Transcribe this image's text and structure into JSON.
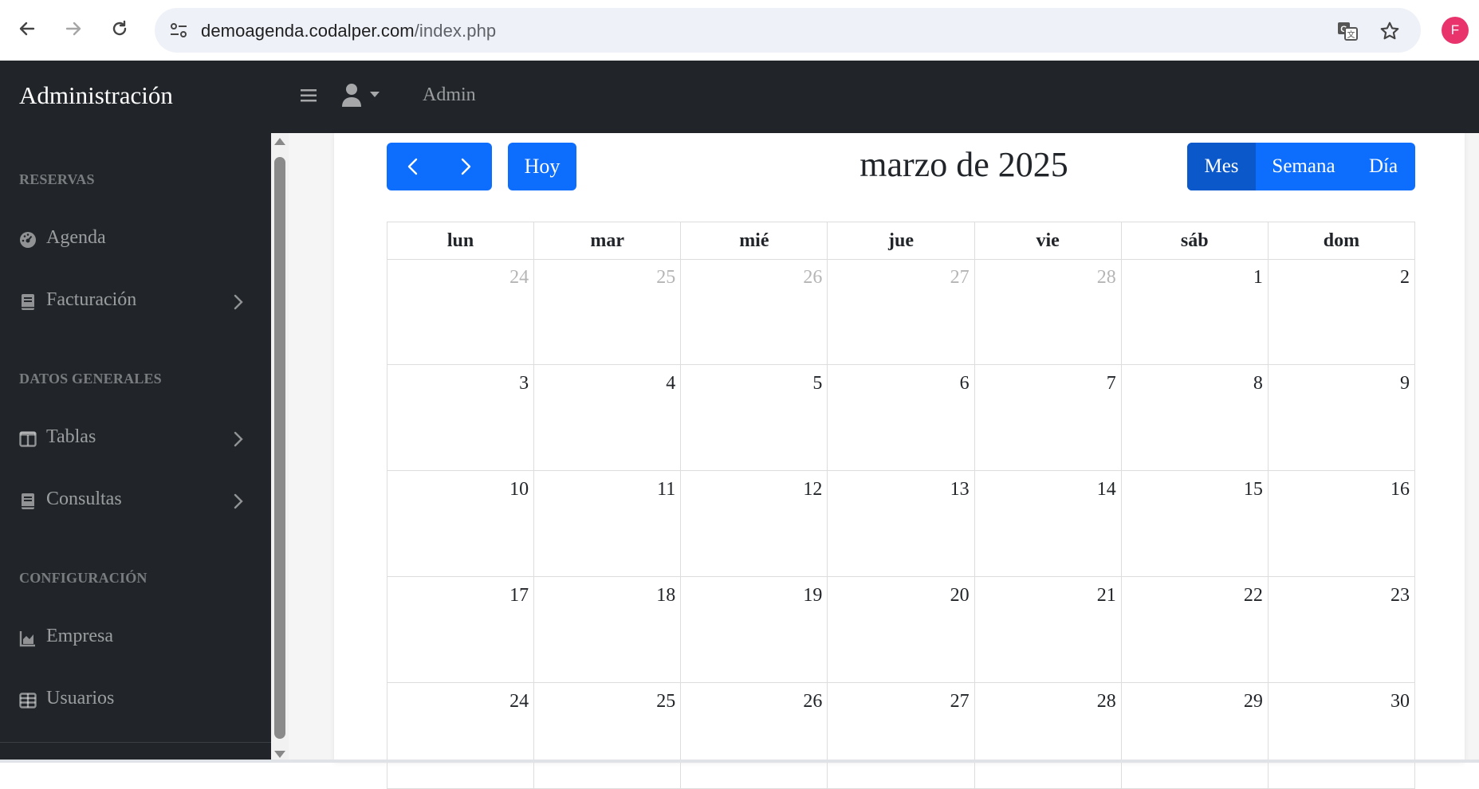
{
  "browser": {
    "url_host": "demoagenda.codalper.com",
    "url_path": "/index.php",
    "profile_initial": "F"
  },
  "app": {
    "brand": "Administración",
    "user_menu_label": "Admin"
  },
  "sidebar": {
    "sections": [
      {
        "heading": "RESERVAS",
        "items": [
          {
            "label": "Agenda",
            "icon": "dashboard-gauge-icon",
            "has_submenu": false
          },
          {
            "label": "Facturación",
            "icon": "book-icon",
            "has_submenu": true
          }
        ]
      },
      {
        "heading": "DATOS GENERALES",
        "items": [
          {
            "label": "Tablas",
            "icon": "columns-icon",
            "has_submenu": true
          },
          {
            "label": "Consultas",
            "icon": "book-icon",
            "has_submenu": true
          }
        ]
      },
      {
        "heading": "CONFIGURACIÓN",
        "items": [
          {
            "label": "Empresa",
            "icon": "chart-area-icon",
            "has_submenu": false
          },
          {
            "label": "Usuarios",
            "icon": "table-icon",
            "has_submenu": false
          }
        ]
      }
    ]
  },
  "calendar": {
    "today_label": "Hoy",
    "title": "marzo de 2025",
    "views": [
      {
        "label": "Mes",
        "active": true
      },
      {
        "label": "Semana",
        "active": false
      },
      {
        "label": "Día",
        "active": false
      }
    ],
    "weekdays": [
      "lun",
      "mar",
      "mié",
      "jue",
      "vie",
      "sáb",
      "dom"
    ],
    "weeks": [
      [
        {
          "d": "24",
          "o": true
        },
        {
          "d": "25",
          "o": true
        },
        {
          "d": "26",
          "o": true
        },
        {
          "d": "27",
          "o": true
        },
        {
          "d": "28",
          "o": true
        },
        {
          "d": "1",
          "o": false
        },
        {
          "d": "2",
          "o": false
        }
      ],
      [
        {
          "d": "3",
          "o": false
        },
        {
          "d": "4",
          "o": false
        },
        {
          "d": "5",
          "o": false
        },
        {
          "d": "6",
          "o": false
        },
        {
          "d": "7",
          "o": false
        },
        {
          "d": "8",
          "o": false
        },
        {
          "d": "9",
          "o": false
        }
      ],
      [
        {
          "d": "10",
          "o": false
        },
        {
          "d": "11",
          "o": false
        },
        {
          "d": "12",
          "o": false
        },
        {
          "d": "13",
          "o": false
        },
        {
          "d": "14",
          "o": false
        },
        {
          "d": "15",
          "o": false
        },
        {
          "d": "16",
          "o": false
        }
      ],
      [
        {
          "d": "17",
          "o": false
        },
        {
          "d": "18",
          "o": false
        },
        {
          "d": "19",
          "o": false
        },
        {
          "d": "20",
          "o": false
        },
        {
          "d": "21",
          "o": false
        },
        {
          "d": "22",
          "o": false
        },
        {
          "d": "23",
          "o": false
        }
      ],
      [
        {
          "d": "24",
          "o": false
        },
        {
          "d": "25",
          "o": false
        },
        {
          "d": "26",
          "o": false
        },
        {
          "d": "27",
          "o": false
        },
        {
          "d": "28",
          "o": false
        },
        {
          "d": "29",
          "o": false
        },
        {
          "d": "30",
          "o": false
        }
      ]
    ]
  },
  "colors": {
    "primary": "#0d6efd",
    "primary_active": "#0a58ca",
    "dark": "#212529"
  }
}
